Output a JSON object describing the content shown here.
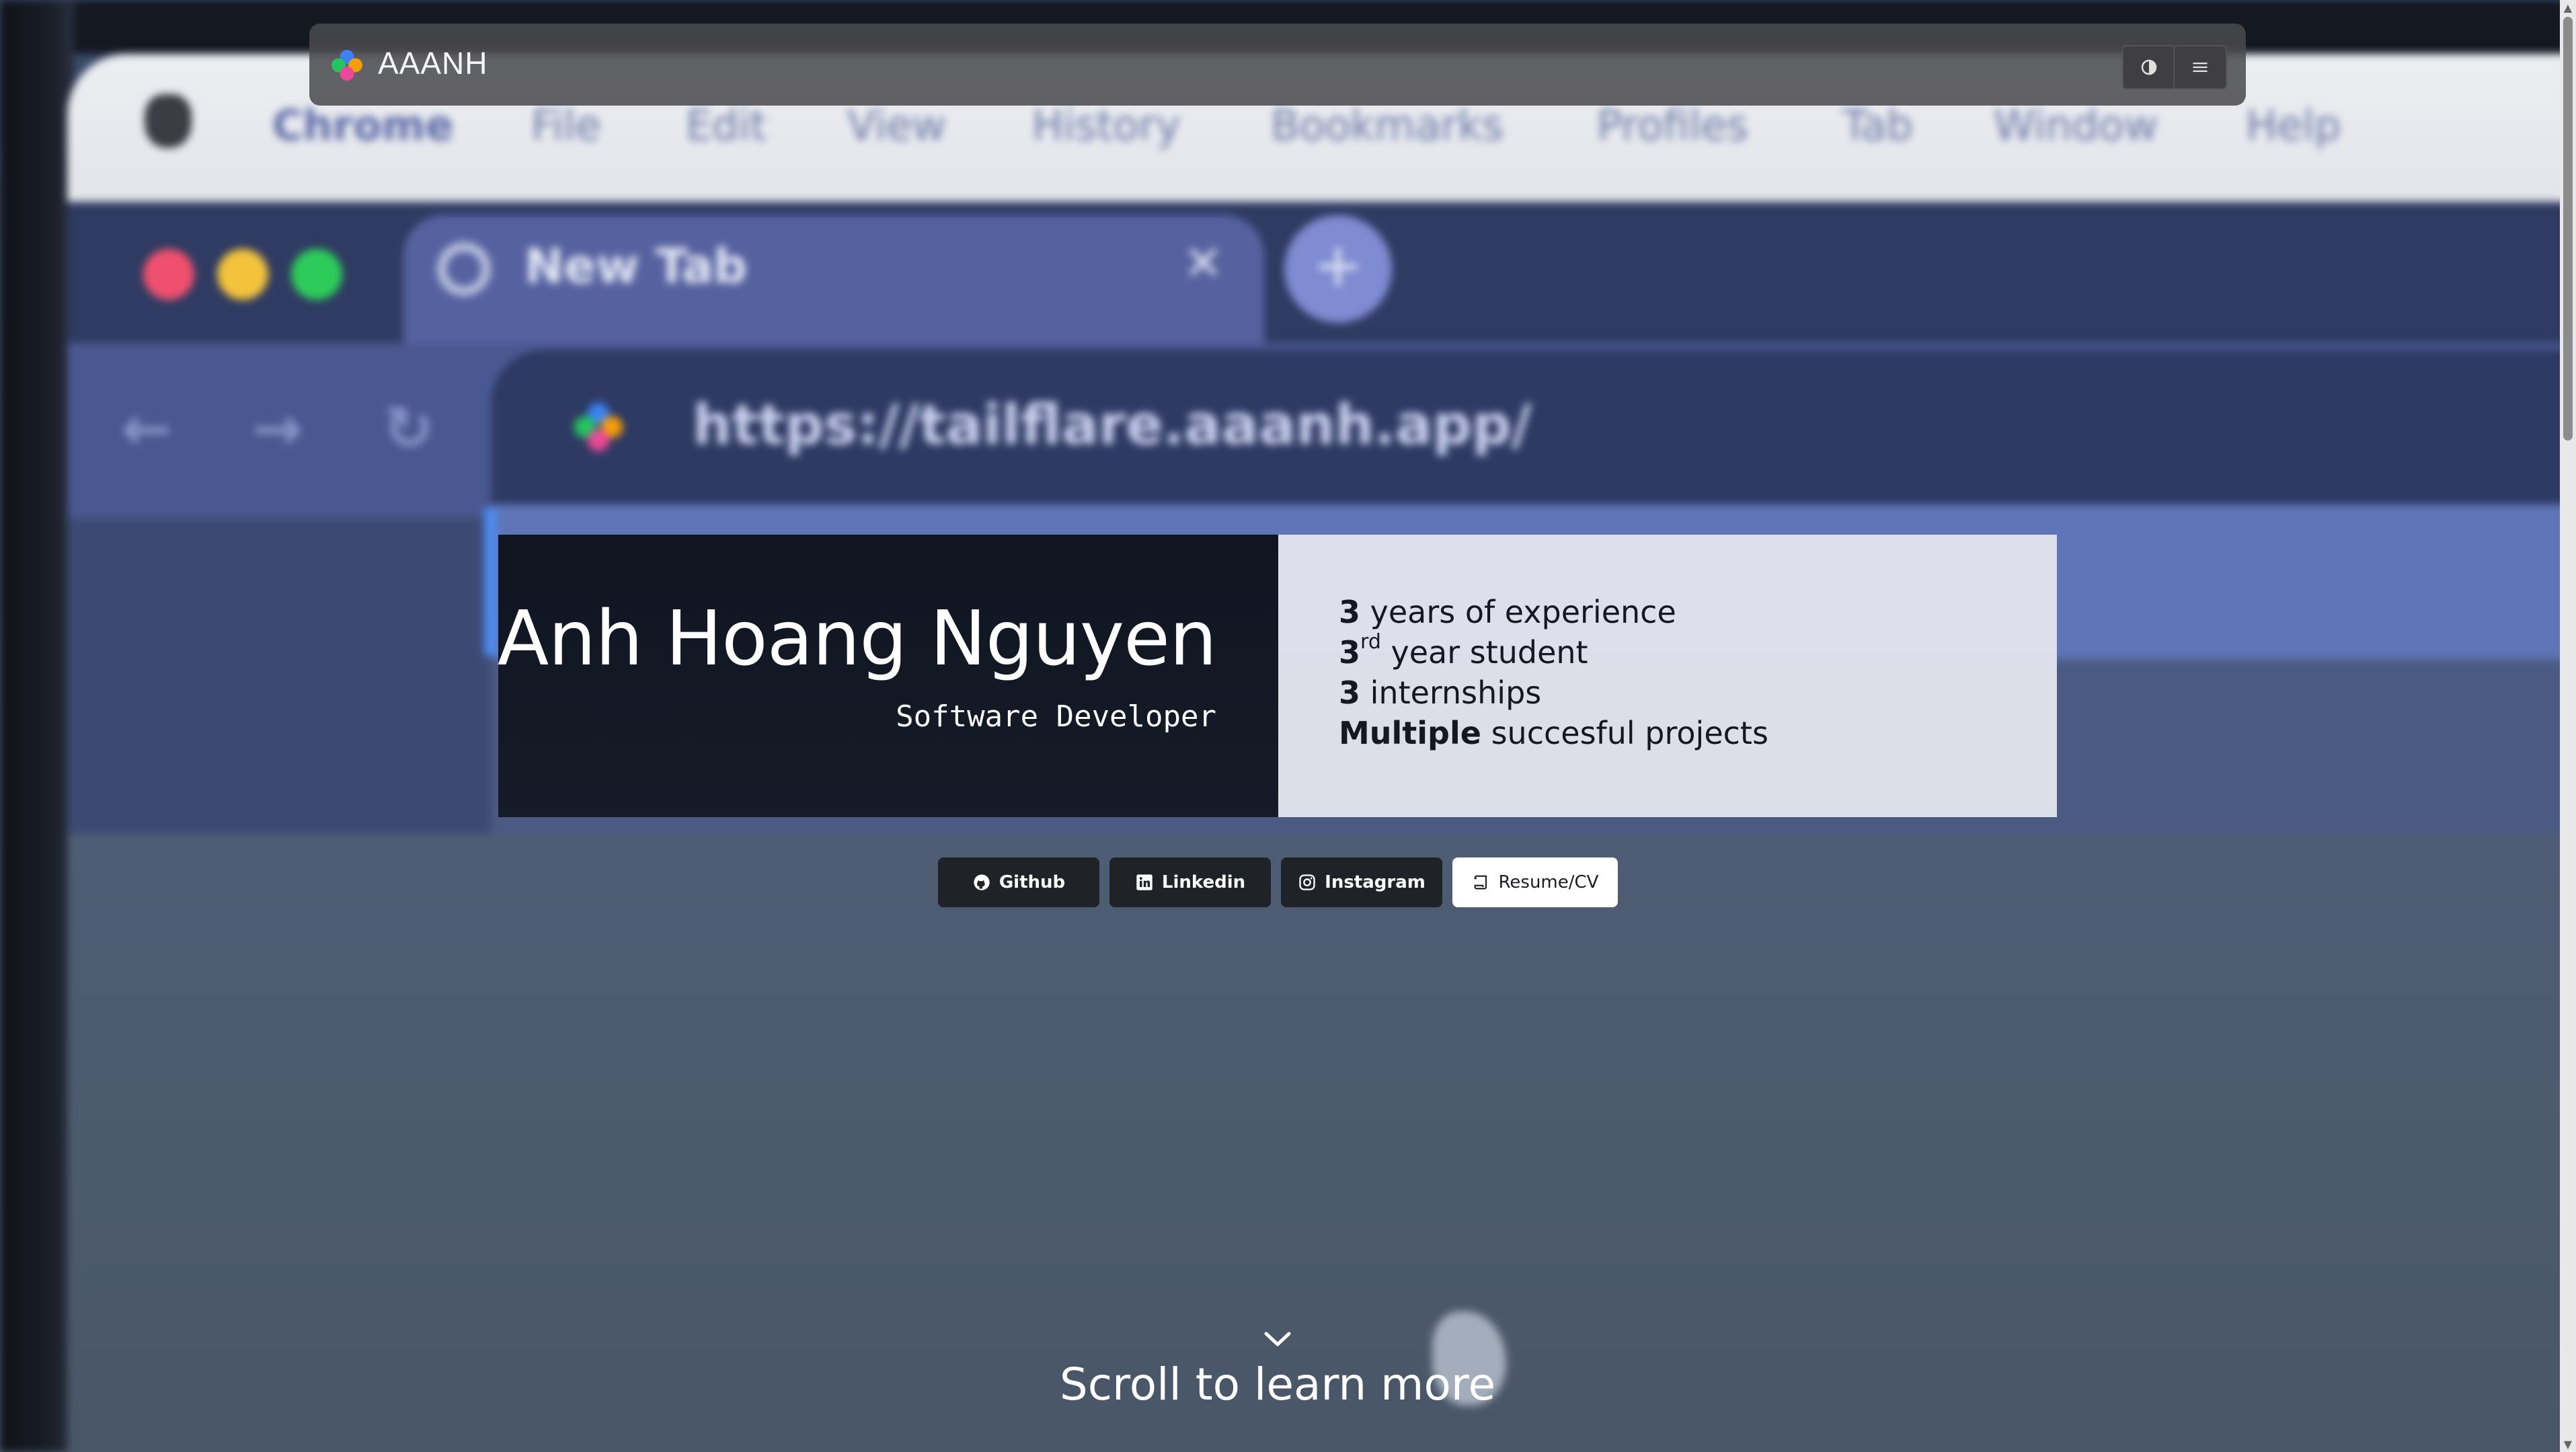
{
  "navbar": {
    "brand": "AAANH",
    "theme_icon": "half-moon-icon",
    "menu_icon": "hamburger-menu-icon"
  },
  "hero": {
    "name": "Anh Hoang Nguyen",
    "role": "Software Developer",
    "stats": [
      {
        "bold": "3",
        "sup": "",
        "rest": " years of experience"
      },
      {
        "bold": "3",
        "sup": "rd",
        "rest": " year student"
      },
      {
        "bold": "3",
        "sup": "",
        "rest": " internships"
      },
      {
        "bold": "Multiple",
        "sup": "",
        "rest": " succesful projects"
      }
    ]
  },
  "social": [
    {
      "label": "Github",
      "icon": "github-icon"
    },
    {
      "label": "Linkedin",
      "icon": "linkedin-icon"
    },
    {
      "label": "Instagram",
      "icon": "instagram-icon"
    },
    {
      "label": "Resume/CV",
      "icon": "scroll-icon"
    }
  ],
  "scroll_hint": {
    "text": "Scroll to learn more",
    "icon": "chevron-down-icon"
  },
  "background": {
    "menubar": [
      "Chrome",
      "File",
      "Edit",
      "View",
      "History",
      "Bookmarks",
      "Profiles",
      "Tab",
      "Window",
      "Help"
    ],
    "tab_title": "New Tab",
    "url": "https://tailflare.aaanh.app/"
  },
  "colors": {
    "hero_dark": "#101522",
    "hero_light": "#e2e4ec",
    "navbar": "#4a4a4e",
    "button_dark": "#1f2226",
    "button_light": "#ffffff",
    "logo_blue": "#3b82f6",
    "logo_orange": "#f59e0b",
    "logo_green": "#22c55e",
    "logo_pink": "#ec4899"
  }
}
